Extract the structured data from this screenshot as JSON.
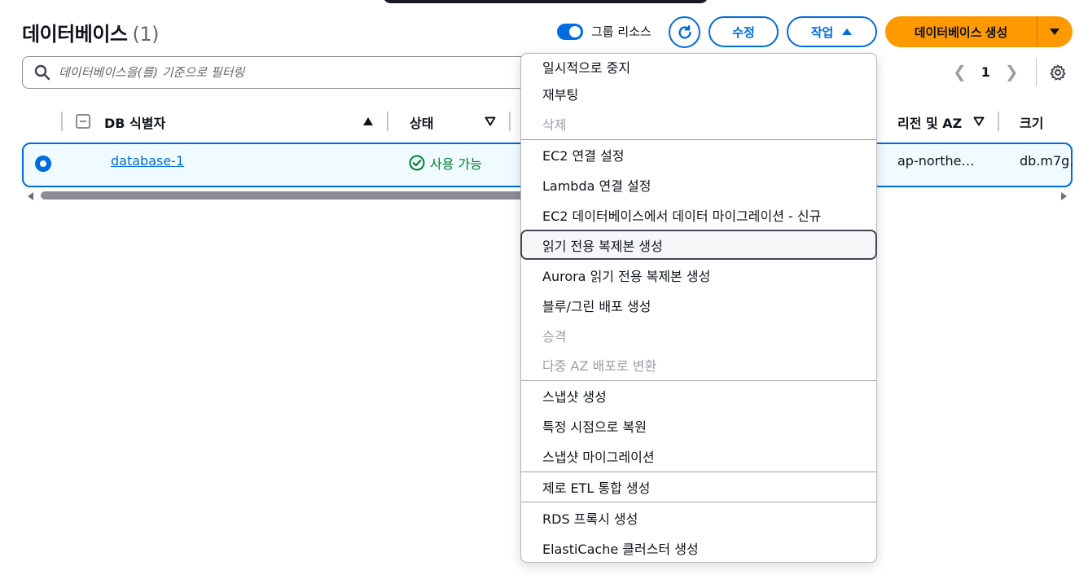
{
  "header": {
    "title": "데이터베이스",
    "count": "(1)",
    "group_toggle_label": "그룹 리소스",
    "edit_label": "수정",
    "actions_label": "작업",
    "create_label": "데이터베이스 생성"
  },
  "search": {
    "placeholder": "데이터베이스을(를) 기준으로 필터링"
  },
  "pagination": {
    "current_page": "1"
  },
  "table": {
    "columns": [
      "DB 식별자",
      "상태",
      "리전 및 AZ",
      "크기"
    ],
    "rows": [
      {
        "id": "database-1",
        "status": "사용 가능",
        "region": "ap-northe…",
        "size": "db.m7g."
      }
    ]
  },
  "actions_menu": {
    "group1": [
      {
        "label": "일시적으로 중지",
        "disabled": false
      },
      {
        "label": "재부팅",
        "disabled": false
      },
      {
        "label": "삭제",
        "disabled": true
      }
    ],
    "group2": [
      {
        "label": "EC2 연결 설정",
        "disabled": false
      },
      {
        "label": "Lambda 연결 설정",
        "disabled": false
      },
      {
        "label": "EC2 데이터베이스에서 데이터 마이그레이션 - 신규",
        "disabled": false
      },
      {
        "label": "읽기 전용 복제본 생성",
        "disabled": false
      },
      {
        "label": "Aurora 읽기 전용 복제본 생성",
        "disabled": false
      },
      {
        "label": "블루/그린 배포 생성",
        "disabled": false
      },
      {
        "label": "승격",
        "disabled": true
      },
      {
        "label": "다중 AZ 배포로 변환",
        "disabled": true
      }
    ],
    "group3": [
      {
        "label": "스냅샷 생성",
        "disabled": false
      },
      {
        "label": "특정 시점으로 복원",
        "disabled": false
      },
      {
        "label": "스냅샷 마이그레이션",
        "disabled": false
      }
    ],
    "group4": [
      {
        "label": "제로 ETL 통합 생성",
        "disabled": false
      }
    ],
    "group5": [
      {
        "label": "RDS 프록시 생성",
        "disabled": false
      },
      {
        "label": "ElastiCache 클러스터 생성",
        "disabled": false
      }
    ]
  },
  "colors": {
    "accent": "#006ce0",
    "primary_button": "#ff9900",
    "status_ok": "#00802f"
  }
}
